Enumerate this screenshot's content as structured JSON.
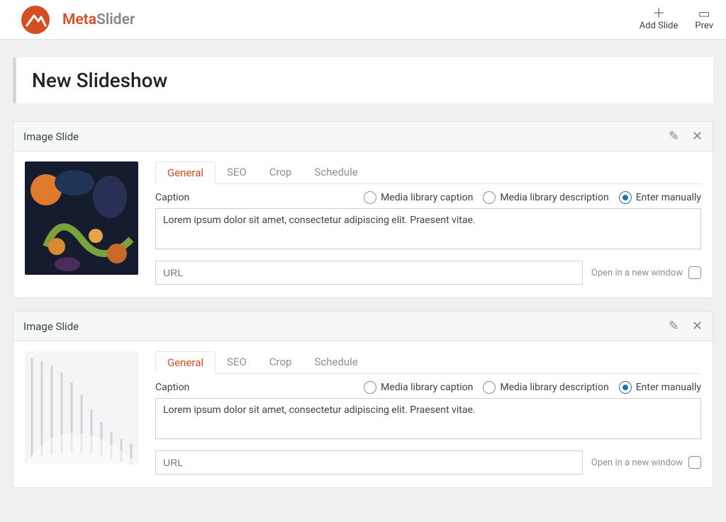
{
  "brand": {
    "accent": "Meta",
    "rest": "Slider"
  },
  "top_actions": {
    "add_slide": "Add Slide",
    "preview": "Prev"
  },
  "page_title": "New Slideshow",
  "slide_header_label": "Image Slide",
  "tabs": {
    "general": "General",
    "seo": "SEO",
    "crop": "Crop",
    "schedule": "Schedule"
  },
  "caption_label": "Caption",
  "radios": {
    "media_caption": "Media library caption",
    "media_description": "Media library description",
    "enter_manually": "Enter manually"
  },
  "url_placeholder": "URL",
  "open_new_window": "Open in a new window",
  "slides": [
    {
      "caption": "Lorem ipsum dolor sit amet, consectetur adipiscing elit. Praesent vitae."
    },
    {
      "caption": "Lorem ipsum dolor sit amet, consectetur adipiscing elit. Praesent vitae."
    }
  ]
}
